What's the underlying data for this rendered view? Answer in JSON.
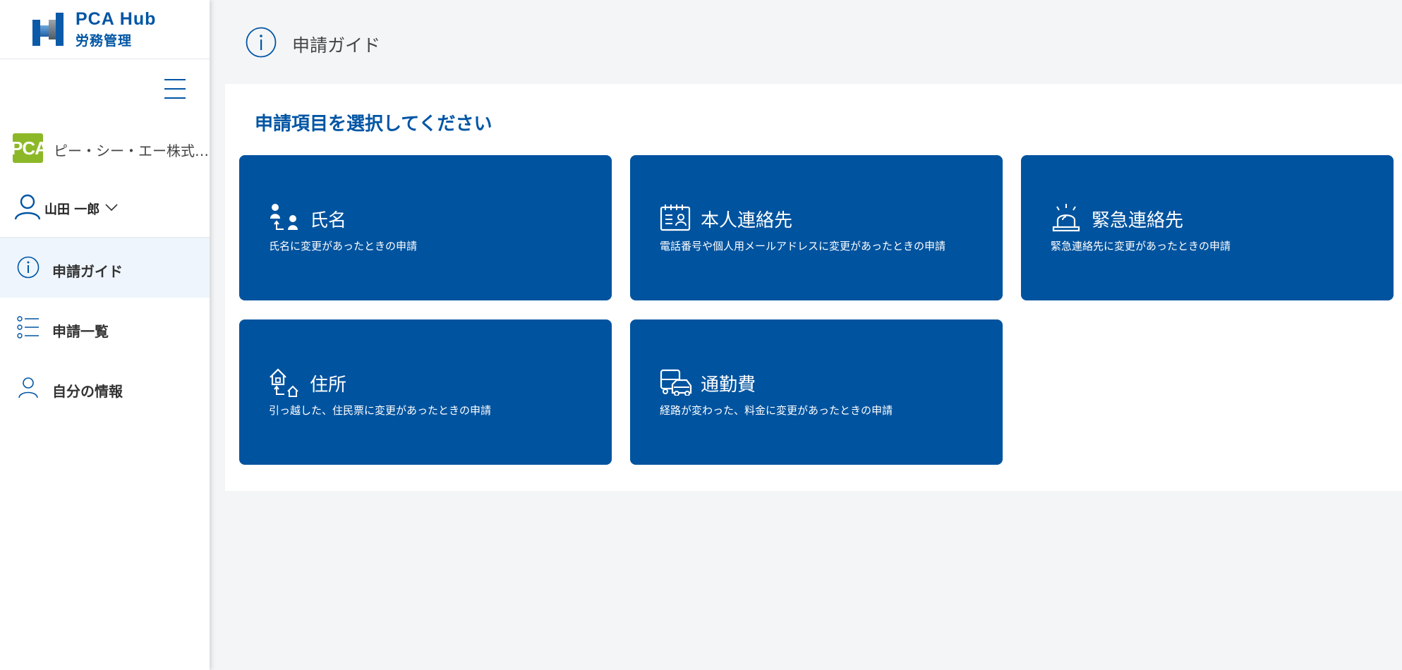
{
  "app": {
    "logo_title": "PCA Hub",
    "logo_subtitle": "労務管理"
  },
  "sidebar": {
    "company_logo_text": "PCA",
    "company_name": "ピー・シー・エー株式会社",
    "user_name": "山田 一郎",
    "nav": [
      {
        "label": "申請ガイド",
        "icon": "info-icon",
        "active": true
      },
      {
        "label": "申請一覧",
        "icon": "list-icon",
        "active": false
      },
      {
        "label": "自分の情報",
        "icon": "person-icon",
        "active": false
      }
    ]
  },
  "header": {
    "title": "申請ガイド"
  },
  "main": {
    "heading": "申請項目を選択してください",
    "cards": [
      {
        "title": "氏名",
        "description": "氏名に変更があったときの申請",
        "icon": "name-change-icon"
      },
      {
        "title": "本人連絡先",
        "description": "電話番号や個人用メールアドレスに変更があったときの申請",
        "icon": "contact-card-icon"
      },
      {
        "title": "緊急連絡先",
        "description": "緊急連絡先に変更があったときの申請",
        "icon": "alarm-light-icon"
      },
      {
        "title": "住所",
        "description": "引っ越した、住民票に変更があったときの申請",
        "icon": "house-move-icon"
      },
      {
        "title": "通勤費",
        "description": "経路が変わった、料金に変更があったときの申請",
        "icon": "commute-icon"
      }
    ]
  },
  "colors": {
    "brand": "#0055a4",
    "card": "#00539f",
    "company_logo": "#8cb828",
    "active_nav": "#eef5fc"
  }
}
